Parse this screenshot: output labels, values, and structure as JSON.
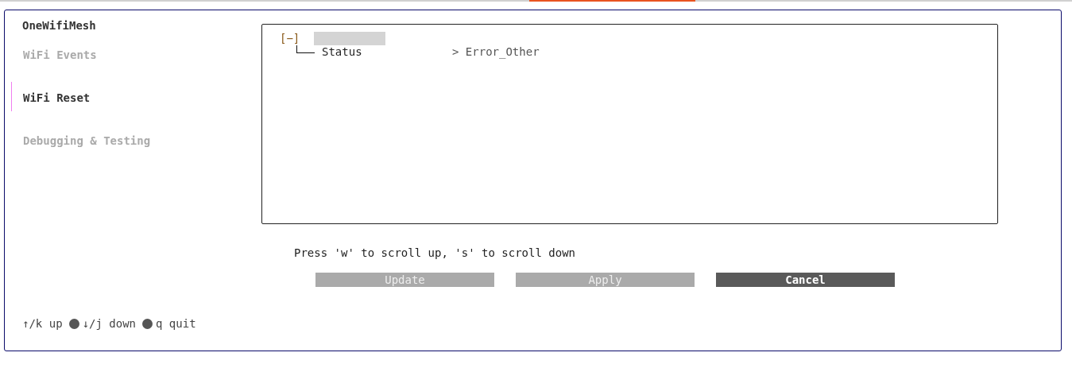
{
  "app_title": "OneWifiMesh",
  "sidebar": {
    "items": [
      {
        "label": "WiFi Events",
        "selected": false
      },
      {
        "label": "WiFi Reset",
        "selected": true
      },
      {
        "label": "Debugging & Testing",
        "selected": false
      }
    ]
  },
  "tree": {
    "toggle": "[−]",
    "expanded": true,
    "children": [
      {
        "label": "Status",
        "value": "> Error_Other"
      }
    ]
  },
  "hint": "Press 'w' to scroll up, 's' to scroll down",
  "buttons": [
    {
      "label": "Update",
      "selected": false
    },
    {
      "label": "Apply",
      "selected": false
    },
    {
      "label": "Cancel",
      "selected": true
    }
  ],
  "help": [
    "↑/k up",
    "↓/j down",
    "q quit"
  ]
}
